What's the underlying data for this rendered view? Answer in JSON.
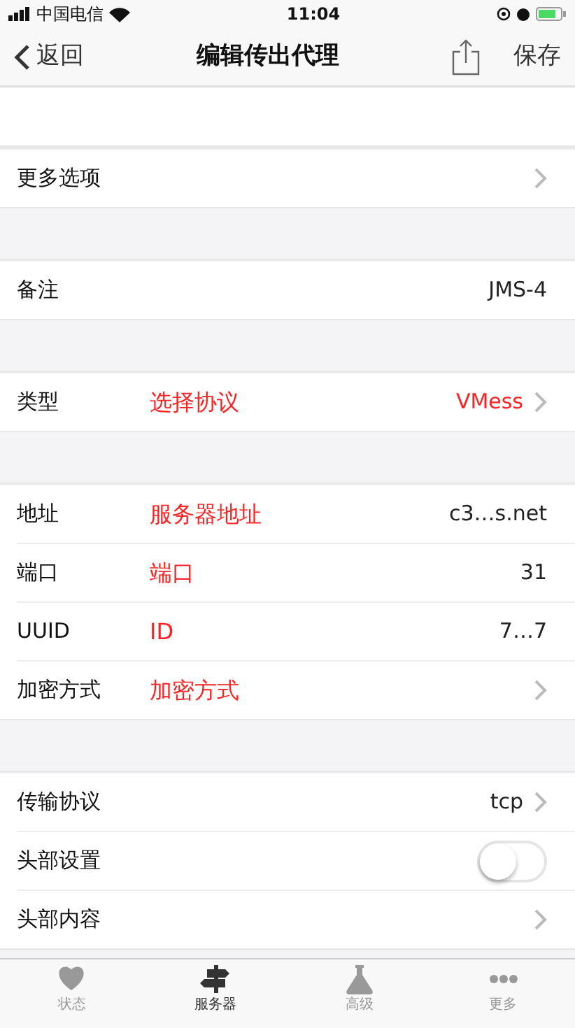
{
  "status_bar": {
    "carrier": "中国电信",
    "time": "11:04"
  },
  "nav": {
    "back": "返回",
    "title": "编辑传出代理",
    "save": "保存"
  },
  "sections": [
    {
      "rows": [
        {
          "kind": "blank"
        }
      ]
    },
    {
      "rows": [
        {
          "kind": "link",
          "label": "更多选项"
        }
      ]
    },
    {
      "rows": [
        {
          "kind": "value",
          "label": "备注",
          "value": "JMS-4"
        }
      ]
    },
    {
      "rows": [
        {
          "kind": "link",
          "label": "类型",
          "note": "选择协议",
          "value": "VMess",
          "value_red": true
        }
      ]
    },
    {
      "rows": [
        {
          "kind": "value",
          "label": "地址",
          "note": "服务器地址",
          "value": "c3…s.net"
        },
        {
          "kind": "value",
          "label": "端口",
          "note": "端口",
          "value": "31"
        },
        {
          "kind": "value",
          "label": "UUID",
          "note": "ID",
          "value": "7…7"
        },
        {
          "kind": "link",
          "label": "加密方式",
          "note": "加密方式"
        }
      ]
    },
    {
      "rows": [
        {
          "kind": "link",
          "label": "传输协议",
          "value": "tcp"
        },
        {
          "kind": "toggle",
          "label": "头部设置",
          "on": false
        },
        {
          "kind": "link",
          "label": "头部内容"
        }
      ]
    }
  ],
  "tabs": [
    {
      "label": "状态",
      "selected": false
    },
    {
      "label": "服务器",
      "selected": true
    },
    {
      "label": "高级",
      "selected": false
    },
    {
      "label": "更多",
      "selected": false
    }
  ]
}
